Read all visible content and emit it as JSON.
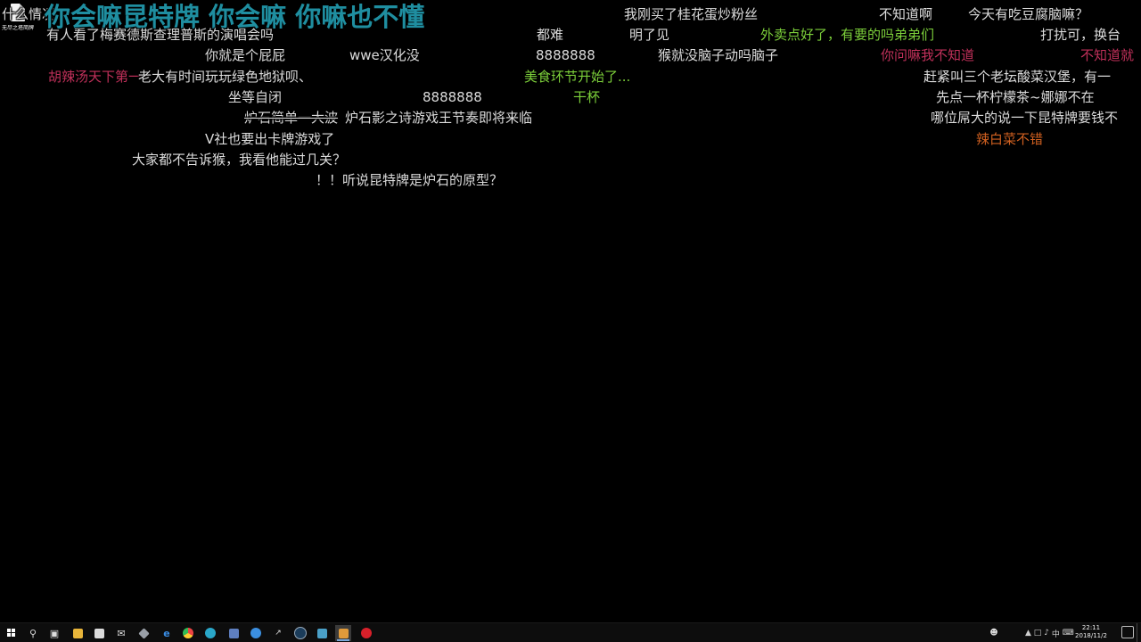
{
  "desktop": {
    "icon_label": "无尽之塔简牌"
  },
  "danmaku": [
    {
      "text": "什么情况",
      "color": "#dcdcdc"
    },
    {
      "text": "你会嘛昆特牌 你会嘛 你嘛也不懂",
      "color": "#1f8ea0"
    },
    {
      "text": "我刚买了桂花蛋炒粉丝",
      "color": "#dcdcdc"
    },
    {
      "text": "不知道啊",
      "color": "#dcdcdc"
    },
    {
      "text": "今天有吃豆腐脑嘛？",
      "color": "#dcdcdc"
    },
    {
      "text": "有人看了梅赛德斯查理普斯的演唱会吗",
      "color": "#dcdcdc"
    },
    {
      "text": "都难",
      "color": "#dcdcdc"
    },
    {
      "text": "明了见",
      "color": "#dcdcdc"
    },
    {
      "text": "外卖点好了，有要的吗弟弟们",
      "color": "#7ccf3a"
    },
    {
      "text": "打扰可，换台",
      "color": "#dcdcdc"
    },
    {
      "text": "你就是个屁屁",
      "color": "#dcdcdc"
    },
    {
      "text": "wwe汉化没",
      "color": "#dcdcdc"
    },
    {
      "text": "8888888",
      "color": "#dcdcdc"
    },
    {
      "text": "猴就没脑子动吗脑子",
      "color": "#dcdcdc"
    },
    {
      "text": "你问嘛我不知道",
      "color": "#c0305a"
    },
    {
      "text": "不知道就",
      "color": "#c0305a"
    },
    {
      "text": "胡辣汤天下第一",
      "color": "#c0305a"
    },
    {
      "text": "老大有时间玩玩绿色地狱呗、",
      "color": "#dcdcdc"
    },
    {
      "text": "美食环节开始了...",
      "color": "#7ccf3a"
    },
    {
      "text": "赶紧叫三个老坛酸菜汉堡，有一",
      "color": "#dcdcdc"
    },
    {
      "text": "坐等自闭",
      "color": "#dcdcdc"
    },
    {
      "text": "8888888",
      "color": "#dcdcdc"
    },
    {
      "text": "干杯",
      "color": "#7ccf3a"
    },
    {
      "text": "先点一杯柠檬茶~娜娜不在",
      "color": "#dcdcdc"
    },
    {
      "text": "炉石简单一大波",
      "color": "#dcdcdc"
    },
    {
      "text": "炉石影之诗游戏王节奏即将来临",
      "color": "#dcdcdc"
    },
    {
      "text": "哪位屌大的说一下昆特牌要钱不",
      "color": "#dcdcdc"
    },
    {
      "text": "V社也要出卡牌游戏了",
      "color": "#dcdcdc"
    },
    {
      "text": "辣白菜不错",
      "color": "#d06020"
    },
    {
      "text": "大家都不告诉猴，我看他能过几关？",
      "color": "#dcdcdc"
    },
    {
      "text": "！！听说昆特牌是炉石的原型？",
      "color": "#dcdcdc"
    }
  ],
  "taskbar": {
    "time": "22:11",
    "date": "2018/11/2"
  }
}
